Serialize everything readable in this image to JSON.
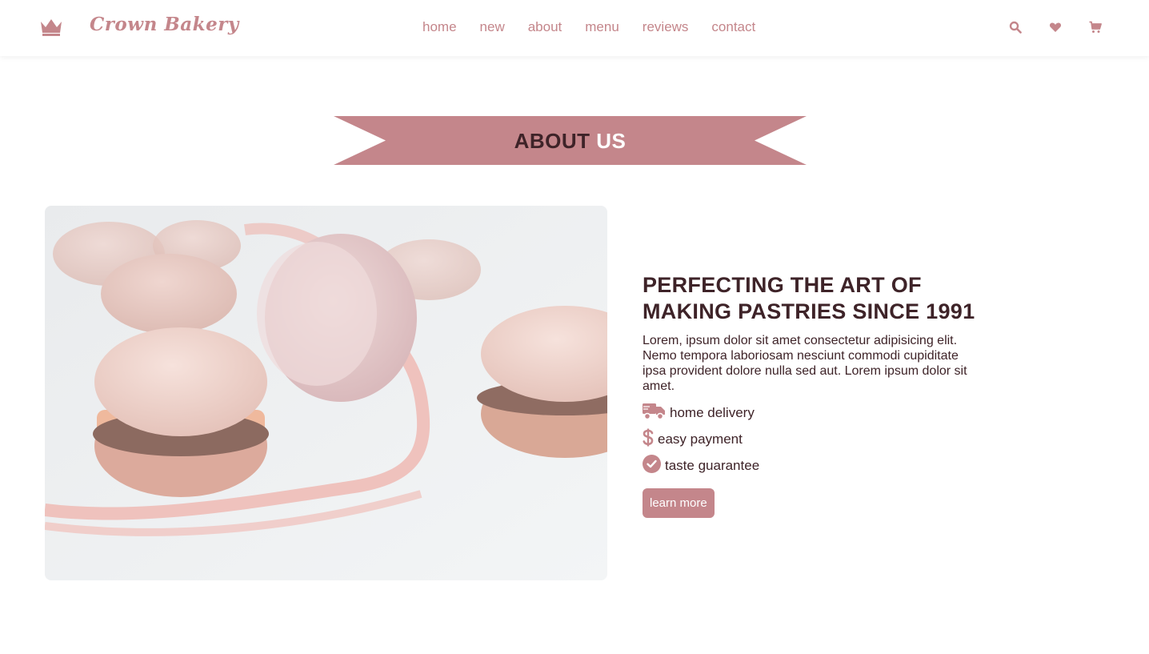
{
  "brand": {
    "name": "Crown Bakery",
    "logo_icon": "crown-icon"
  },
  "nav": {
    "items": [
      {
        "label": "home"
      },
      {
        "label": "new"
      },
      {
        "label": "about"
      },
      {
        "label": "menu"
      },
      {
        "label": "reviews"
      },
      {
        "label": "contact"
      }
    ]
  },
  "header_icons": [
    "search-icon",
    "heart-icon",
    "cart-icon"
  ],
  "section": {
    "title_part1": "ABOUT",
    "title_part2": "US"
  },
  "about": {
    "heading": "PERFECTING THE ART OF MAKING PASTRIES SINCE 1991",
    "paragraph": "Lorem, ipsum dolor sit amet consectetur adipisicing elit. Nemo tempora laboriosam nesciunt commodi cupiditate ipsa provident dolore nulla sed aut. Lorem ipsum dolor sit amet.",
    "features": [
      {
        "icon": "truck-icon",
        "label": "home delivery"
      },
      {
        "icon": "dollar-icon",
        "label": "easy payment"
      },
      {
        "icon": "check-circle-icon",
        "label": "taste guarantee"
      }
    ],
    "button_label": "learn more"
  },
  "colors": {
    "accent": "#c4868b",
    "dark": "#3e2328",
    "background": "#ffffff"
  }
}
